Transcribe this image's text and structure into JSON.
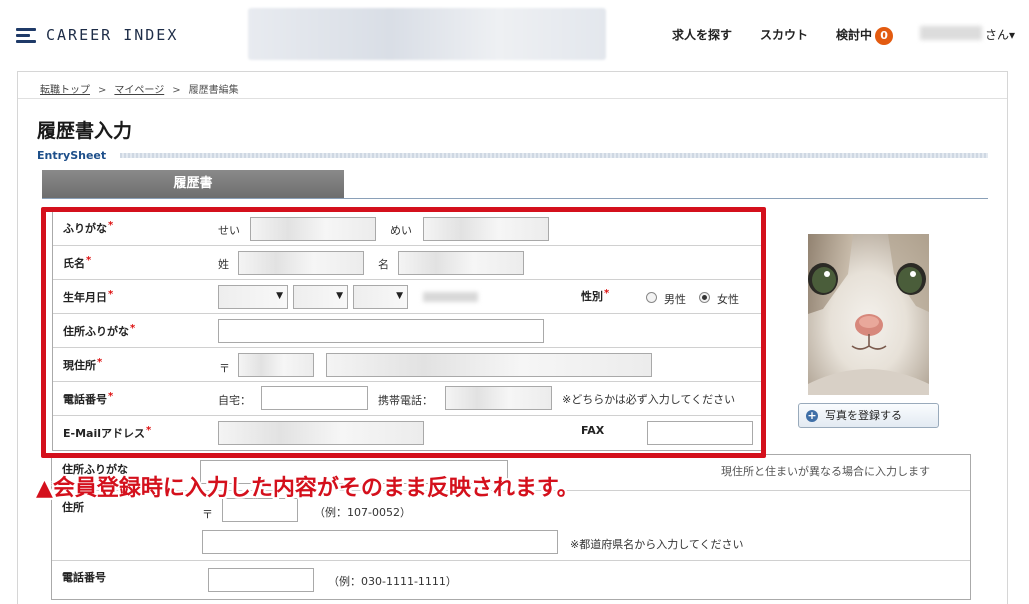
{
  "header": {
    "logo_text": "CAREER INDEX",
    "nav_search": "求人を探す",
    "nav_scout": "スカウト",
    "nav_consider": "検討中",
    "consider_count": "0",
    "user_suffix": "さん▾"
  },
  "breadcrumb": {
    "top": "転職トップ",
    "mypage": "マイページ",
    "current": "履歴書編集",
    "sep": ">"
  },
  "page": {
    "title": "履歴書入力",
    "subtitle": "EntrySheet",
    "tab": "履歴書"
  },
  "form": {
    "furigana": {
      "label": "ふりがな",
      "sei": "せい",
      "mei": "めい"
    },
    "name": {
      "label": "氏名",
      "sei": "姓",
      "mei": "名"
    },
    "birth": {
      "label": "生年月日"
    },
    "gender": {
      "label": "性別",
      "male": "男性",
      "female": "女性",
      "selected": "female"
    },
    "address_kana": {
      "label": "住所ふりがな"
    },
    "address": {
      "label": "現住所",
      "postal_mark": "〒"
    },
    "phone": {
      "label": "電話番号",
      "home": "自宅：",
      "mobile": "携帯電話：",
      "note": "※どちらかは必ず入力してください"
    },
    "email": {
      "label": "E-Mailアドレス",
      "fax": "FAX"
    },
    "required_mark": "*"
  },
  "lower": {
    "kana_label": "住所ふりがな",
    "note_top": "現住所と住まいが異なる場合に入力します",
    "addr_label": "住所",
    "postal_mark": "〒",
    "postal_example": "（例：107-0052）",
    "pref_note": "※都道府県名から入力してください",
    "phone_label": "電話番号",
    "phone_example": "（例：030-1111-1111）"
  },
  "annotation": "▲会員登録時に入力した内容がそのまま反映されます。",
  "photo": {
    "button_label": "写真を登録する"
  },
  "colors": {
    "accent_red": "#d4101c",
    "badge": "#e35b10",
    "brand_navy": "#1e2d48"
  }
}
